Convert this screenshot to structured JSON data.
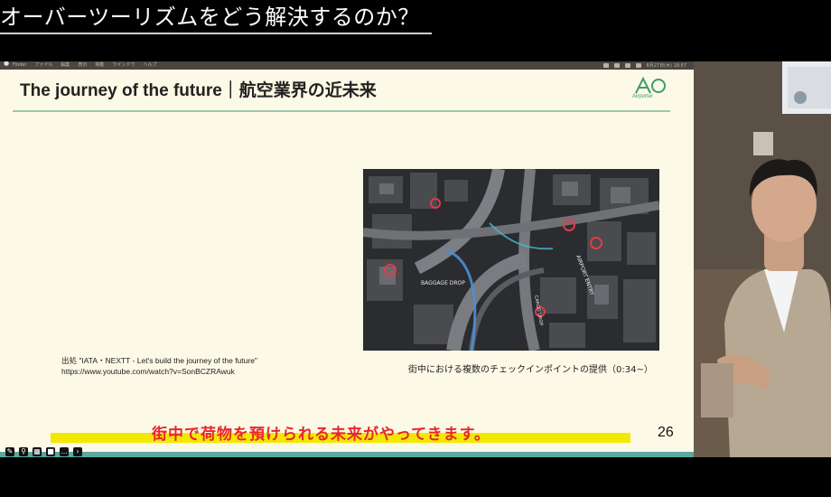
{
  "video": {
    "title": "オーバーツーリズムをどう解決するのか？"
  },
  "menubar": {
    "apple_icon": "apple-icon",
    "items": [
      "Finder",
      "ファイル",
      "編集",
      "表示",
      "移動",
      "ウインドウ",
      "ヘルプ"
    ],
    "clock": "8月27日(木) 18:57"
  },
  "slide": {
    "title": "The journey of the future｜航空業界の近未来",
    "logo_text": "Airporter",
    "image_labels": [
      "AIRPORT ENTRY",
      "BAGGAGE DROP",
      "CARGO DROP"
    ],
    "caption": "街中における複数のチェックインポイントの提供（0:34~）",
    "source_line1": "出処 \"IATA・NEXTT - Let's build the journey of the future\"",
    "source_line2": "https://www.youtube.com/watch?v=SonBCZRAwuk",
    "subtitle": "街中で荷物を預けられる未来がやってきます。",
    "page_number": "26"
  },
  "toolbar": {
    "tools": [
      "pen-icon",
      "zoom-icon",
      "slides-icon",
      "camera-icon",
      "more-icon",
      "next-icon"
    ]
  },
  "colors": {
    "slide_bg": "#fcf9e6",
    "accent_green": "#9cc9ab",
    "subtitle_red": "#e8262e",
    "highlight_yellow": "#f2e800"
  }
}
